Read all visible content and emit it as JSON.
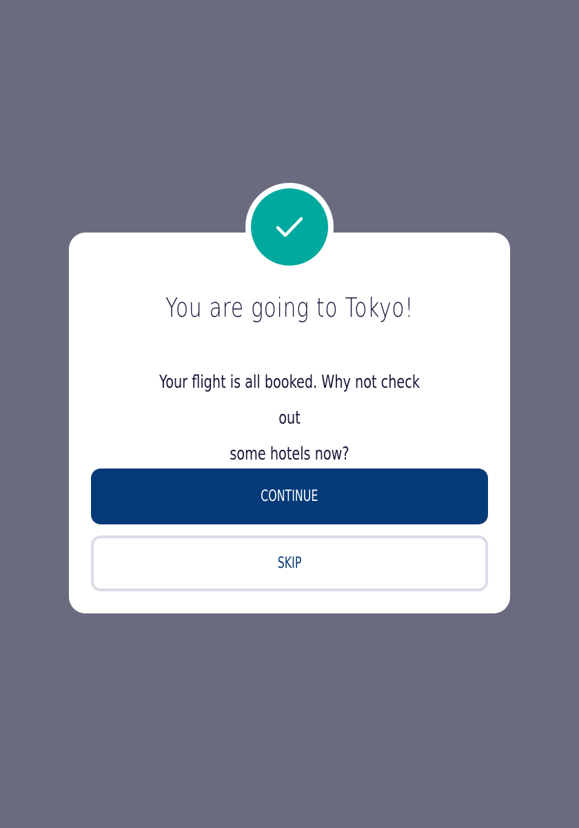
{
  "dialog": {
    "title": "You are going to Tokyo!",
    "message_line1": "Your flight is all booked. Why not check out",
    "message_line2": "some hotels now?",
    "status_icon": "check-icon"
  },
  "actions": {
    "continue_label": "CONTINUE",
    "skip_label": "SKIP"
  },
  "colors": {
    "backdrop": "#6b6b80",
    "success": "#00a99d",
    "primary": "#043a78",
    "text": "#16163a"
  }
}
